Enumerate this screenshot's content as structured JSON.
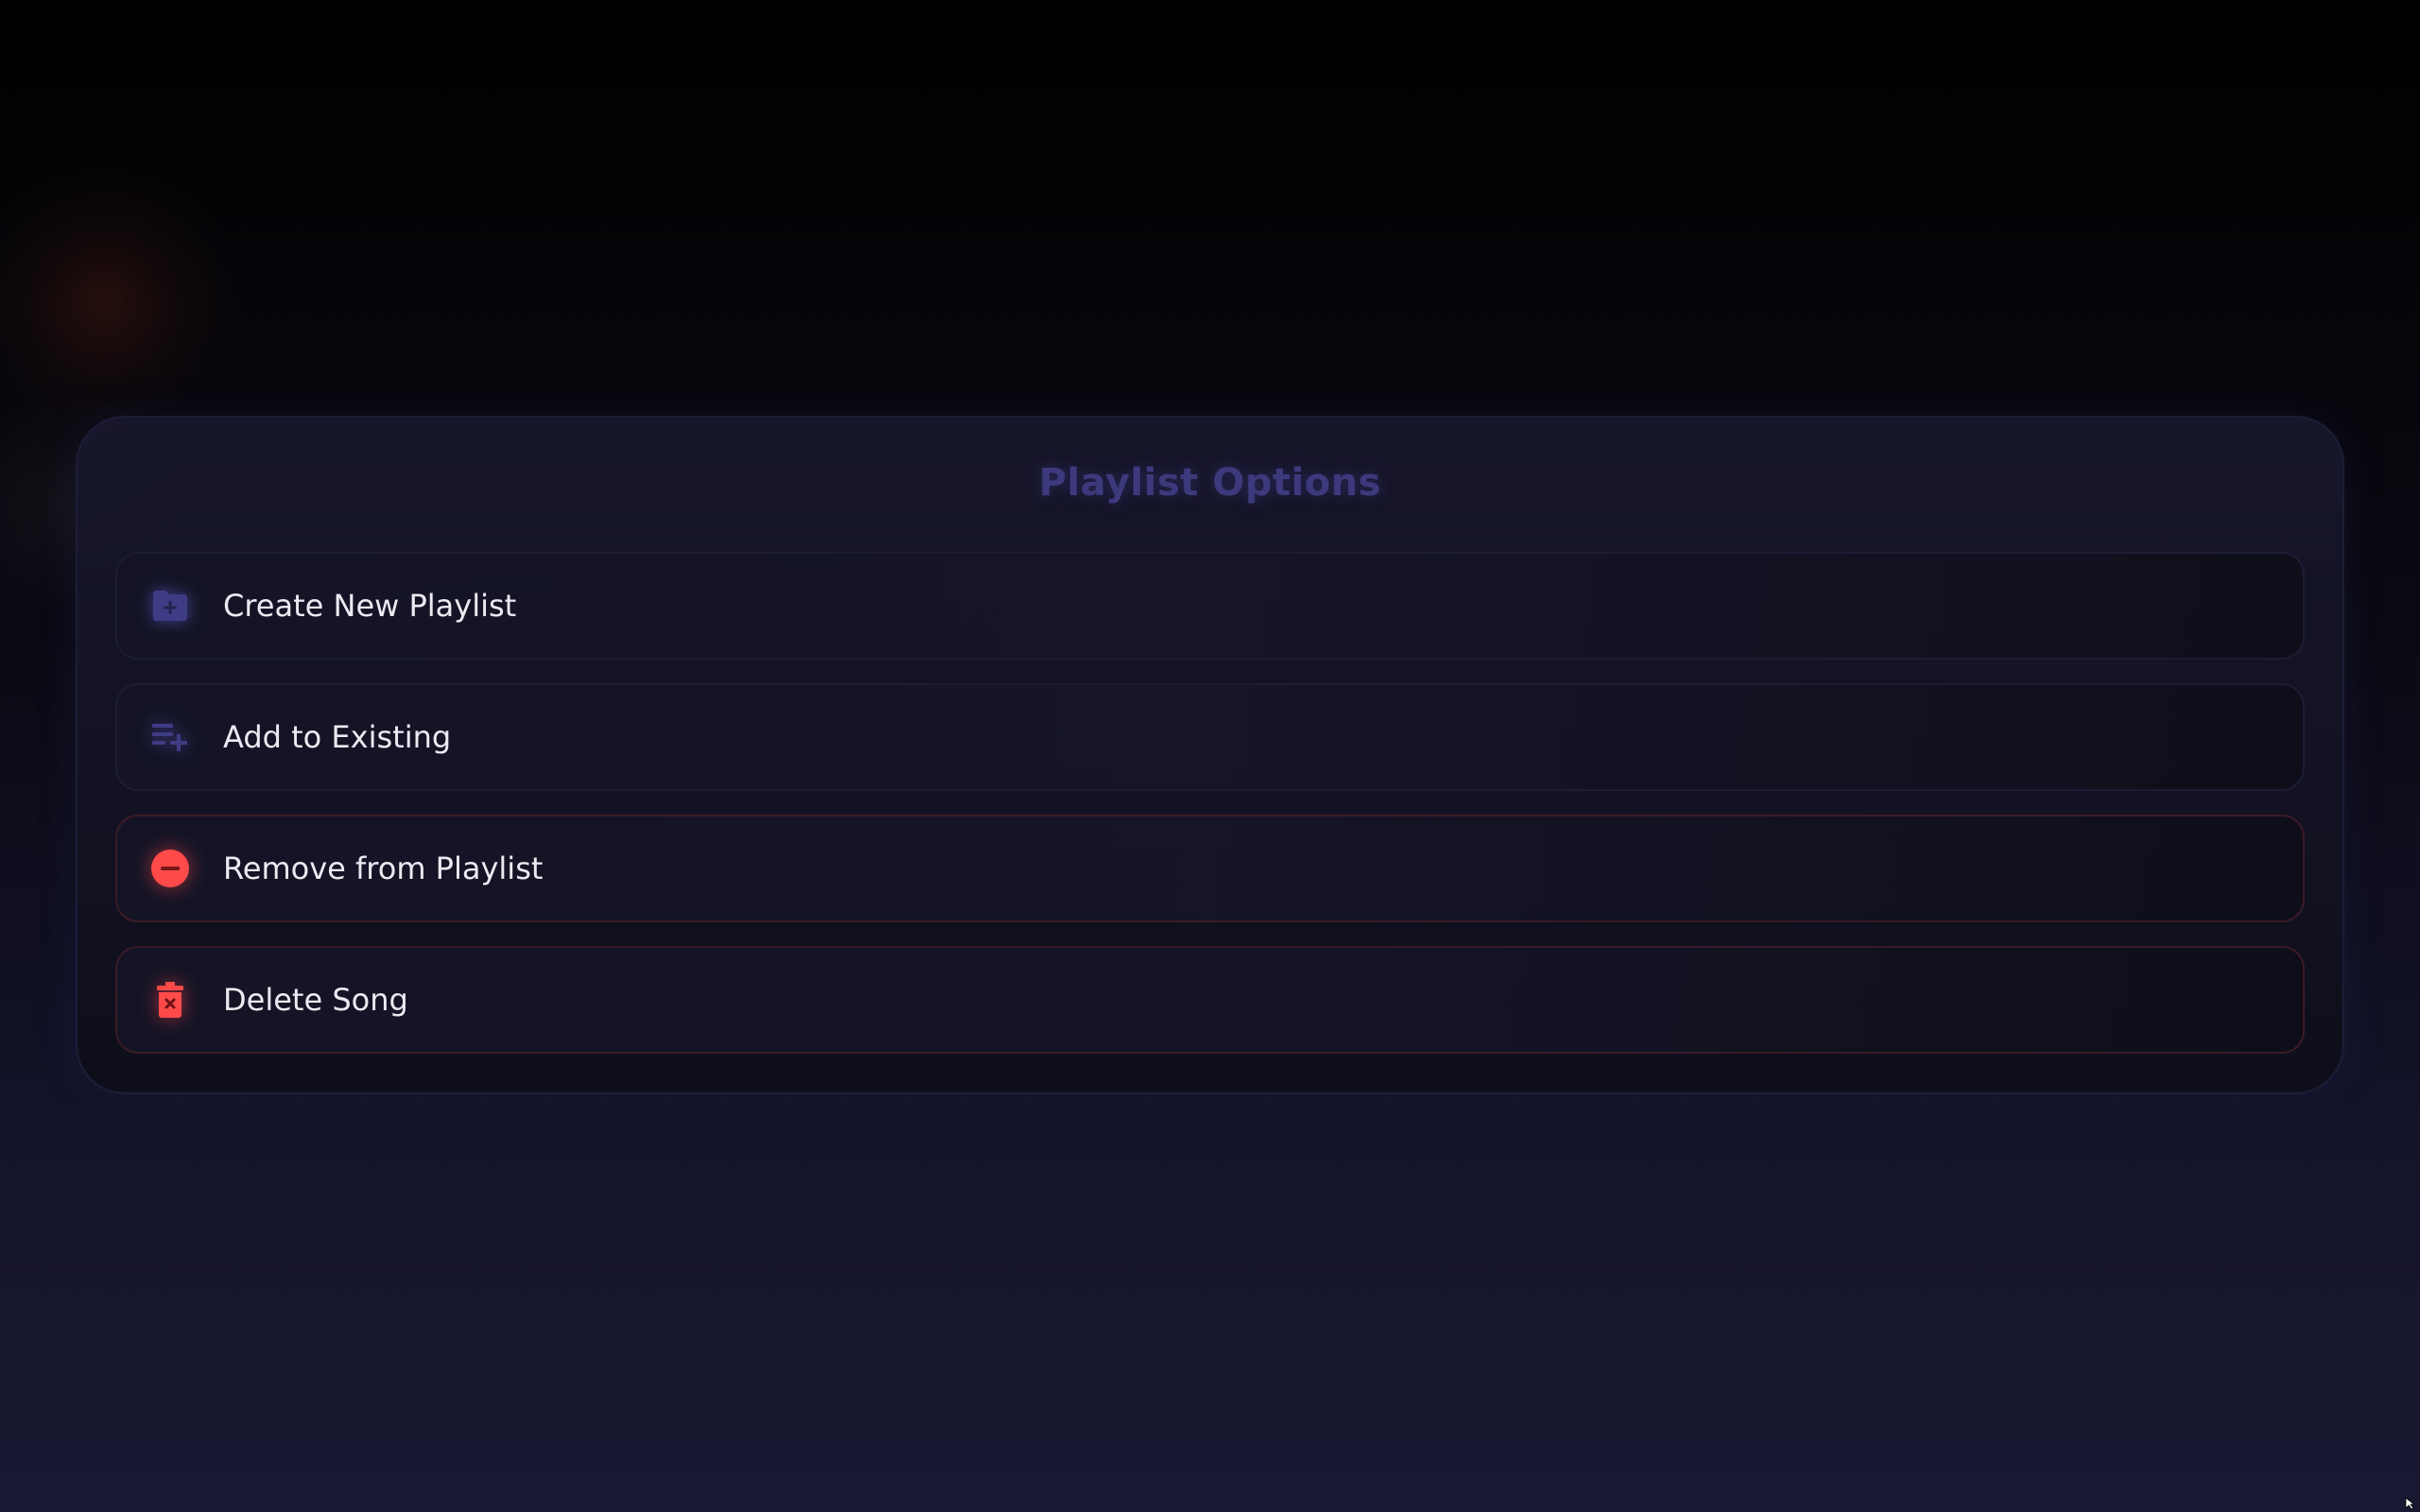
{
  "panel": {
    "title": "Playlist Options"
  },
  "options": [
    {
      "label": "Create New Playlist",
      "icon": "folder-plus-icon",
      "color": "#3f3c86"
    },
    {
      "label": "Add to Existing",
      "icon": "playlist-add-icon",
      "color": "#3f3c86"
    },
    {
      "label": "Remove from Playlist",
      "icon": "minus-circle-icon",
      "color": "#ff4a4a"
    },
    {
      "label": "Delete Song",
      "icon": "trash-icon",
      "color": "#ff4a4a"
    }
  ],
  "colors": {
    "title": "#3c3a7c",
    "accent": "#3f3c86",
    "danger": "#ff4a4a",
    "text": "#ebeaf2"
  }
}
